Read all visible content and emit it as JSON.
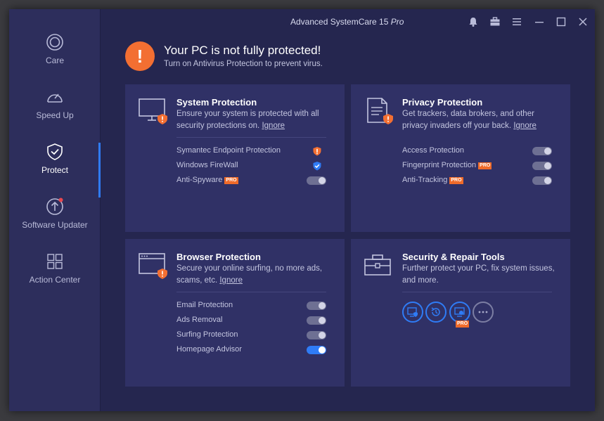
{
  "app": {
    "title": "Advanced SystemCare 15",
    "edition": "Pro"
  },
  "sidebar": {
    "items": [
      {
        "label": "Care",
        "icon": "care-icon",
        "active": false
      },
      {
        "label": "Speed Up",
        "icon": "speedometer-icon",
        "active": false
      },
      {
        "label": "Protect",
        "icon": "shield-check-icon",
        "active": true
      },
      {
        "label": "Software Updater",
        "icon": "update-arrow-icon",
        "active": false,
        "badge": true
      },
      {
        "label": "Action Center",
        "icon": "grid-icon",
        "active": false
      }
    ]
  },
  "titlebar_icons": [
    "bell-icon",
    "toolbox-icon",
    "menu-icon",
    "minimize-icon",
    "maximize-icon",
    "close-icon"
  ],
  "alert": {
    "symbol": "!",
    "title": "Your PC is not fully protected!",
    "subtitle": "Turn on Antivirus Protection to prevent virus."
  },
  "cards": {
    "system": {
      "title": "System Protection",
      "desc": "Ensure your system is protected with all security protections on.",
      "ignore": "Ignore",
      "rows": [
        {
          "label": "Symantec Endpoint Protection",
          "status": "warning"
        },
        {
          "label": "Windows FireWall",
          "status": "protected"
        },
        {
          "label": "Anti-Spyware",
          "pro": "PRO",
          "toggle": "off"
        }
      ]
    },
    "privacy": {
      "title": "Privacy Protection",
      "desc": "Get trackers, data brokers, and other privacy invaders off your back.",
      "ignore": "Ignore",
      "rows": [
        {
          "label": "Access Protection",
          "toggle": "off"
        },
        {
          "label": "Fingerprint Protection",
          "pro": "PRO",
          "toggle": "off"
        },
        {
          "label": "Anti-Tracking",
          "pro": "PRO",
          "toggle": "off"
        }
      ]
    },
    "browser": {
      "title": "Browser Protection",
      "desc": "Secure your online surfing, no more ads, scams, etc.",
      "ignore": "Ignore",
      "rows": [
        {
          "label": "Email Protection",
          "toggle": "off"
        },
        {
          "label": "Ads Removal",
          "toggle": "off"
        },
        {
          "label": "Surfing Protection",
          "toggle": "off"
        },
        {
          "label": "Homepage Advisor",
          "toggle": "on"
        }
      ]
    },
    "tools": {
      "title": "Security & Repair Tools",
      "desc": "Further protect your PC, fix system issues, and more.",
      "pro": "PRO"
    }
  },
  "colors": {
    "accent": "#2f7cf6",
    "warning": "#f36f32",
    "bg": "#25264f",
    "card": "#303166"
  }
}
